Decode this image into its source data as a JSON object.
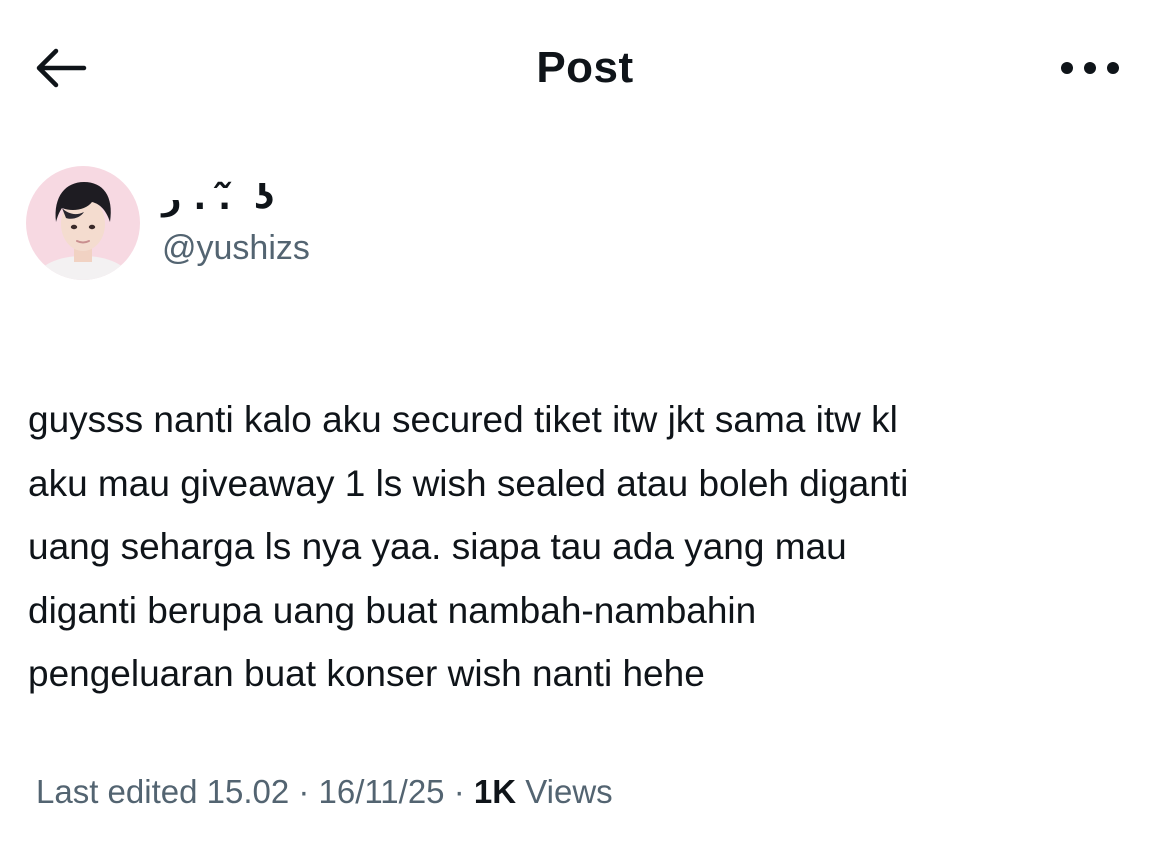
{
  "header": {
    "title": "Post"
  },
  "author": {
    "display_name": "ﺭ . . ᷉ ʖ",
    "handle": "@yushizs"
  },
  "post": {
    "lines": [
      "guysss nanti kalo aku secured tiket itw jkt sama itw kl",
      "aku mau giveaway 1 ls wish sealed atau boleh diganti",
      "uang seharga ls nya yaa. siapa tau ada yang mau",
      "diganti berupa uang buat nambah-nambahin",
      "pengeluaran buat konser wish nanti hehe"
    ]
  },
  "meta": {
    "edited_label": "Last edited 15.02 · 16/11/25",
    "separator": " · ",
    "views_count": "1K",
    "views_label": " Views"
  },
  "icons": {
    "back": "arrow-left-icon",
    "more": "more-horizontal-icon"
  },
  "colors": {
    "text_primary": "#0f1419",
    "text_secondary": "#536471",
    "background": "#ffffff"
  }
}
